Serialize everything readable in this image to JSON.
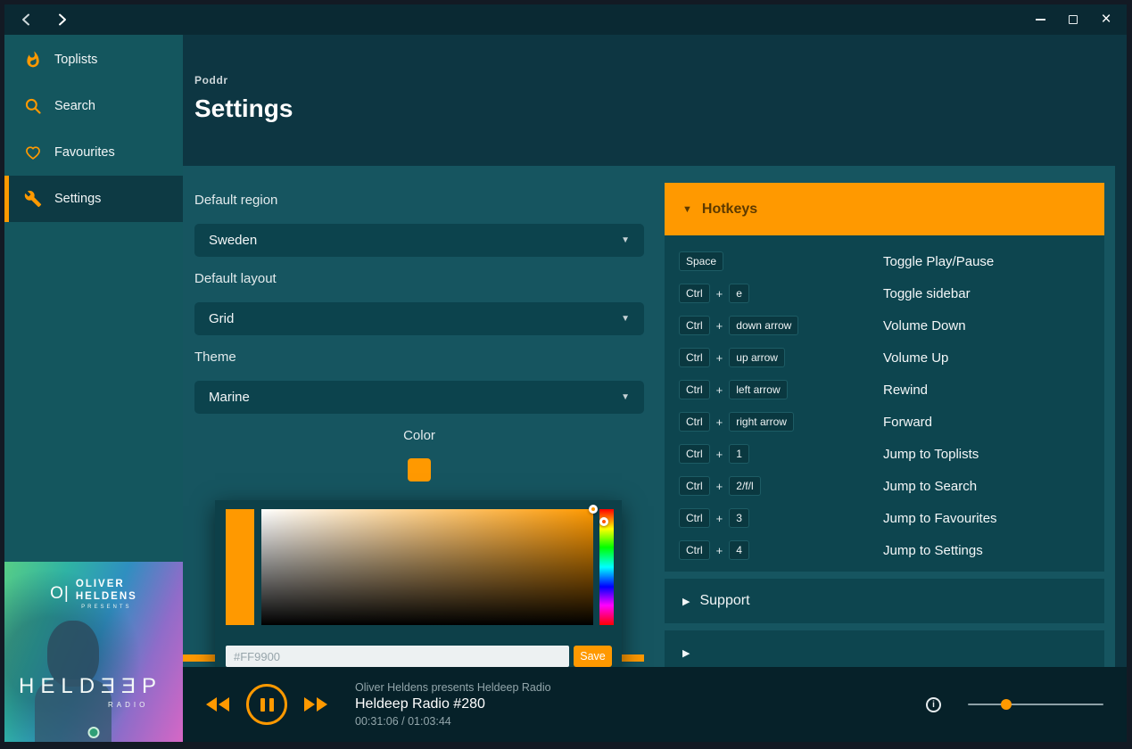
{
  "window": {
    "nav": {
      "back_icon": "chevron-left",
      "forward_icon": "chevron-right"
    },
    "controls": {
      "minimize_icon": "minimize-dash",
      "maximize_icon": "maximize-square",
      "close_glyph": "×"
    }
  },
  "colors": {
    "accent": "#FF9900",
    "titlebar": "#0A2933",
    "background": "#0D3642",
    "sidebar": "#14565E",
    "panel": "#165560",
    "player_bar": "#062129"
  },
  "sidebar": {
    "items": [
      {
        "label": "Toplists",
        "icon": "flame-icon",
        "active": false
      },
      {
        "label": "Search",
        "icon": "search-icon",
        "active": false
      },
      {
        "label": "Favourites",
        "icon": "heart-icon",
        "active": false
      },
      {
        "label": "Settings",
        "icon": "tools-icon",
        "active": true
      }
    ]
  },
  "header": {
    "app_name": "Poddr",
    "page_title": "Settings"
  },
  "settings": {
    "fields": [
      {
        "label": "Default region",
        "value": "Sweden"
      },
      {
        "label": "Default layout",
        "value": "Grid"
      },
      {
        "label": "Theme",
        "value": "Marine"
      }
    ],
    "color": {
      "label": "Color",
      "swatch_color": "#FF9900",
      "picker": {
        "input_value": "#FF9900",
        "save_label": "Save"
      }
    }
  },
  "hotkeys": {
    "title": "Hotkeys",
    "expanded": true,
    "rows": [
      {
        "keys": [
          "Space"
        ],
        "action": "Toggle Play/Pause"
      },
      {
        "keys": [
          "Ctrl",
          "e"
        ],
        "action": "Toggle sidebar"
      },
      {
        "keys": [
          "Ctrl",
          "down arrow"
        ],
        "action": "Volume Down"
      },
      {
        "keys": [
          "Ctrl",
          "up arrow"
        ],
        "action": "Volume Up"
      },
      {
        "keys": [
          "Ctrl",
          "left arrow"
        ],
        "action": "Rewind"
      },
      {
        "keys": [
          "Ctrl",
          "right arrow"
        ],
        "action": "Forward"
      },
      {
        "keys": [
          "Ctrl",
          "1"
        ],
        "action": "Jump to Toplists"
      },
      {
        "keys": [
          "Ctrl",
          "2/f/l"
        ],
        "action": "Jump to Search"
      },
      {
        "keys": [
          "Ctrl",
          "3"
        ],
        "action": "Jump to Favourites"
      },
      {
        "keys": [
          "Ctrl",
          "4"
        ],
        "action": "Jump to Settings"
      }
    ]
  },
  "support": {
    "title": "Support",
    "expanded": false
  },
  "player": {
    "show_title": "Oliver Heldens presents Heldeep Radio",
    "episode_title": "Heldeep Radio #280",
    "time": "00:31:06 / 01:03:44",
    "volume_percent": 28
  },
  "album_art": {
    "monogram": "O|",
    "artist_line1": "OLIVER",
    "artist_line2": "HELDENS",
    "presents": "PRESENTS",
    "title": "HELDƎƎP",
    "subtitle": "RADIO"
  }
}
